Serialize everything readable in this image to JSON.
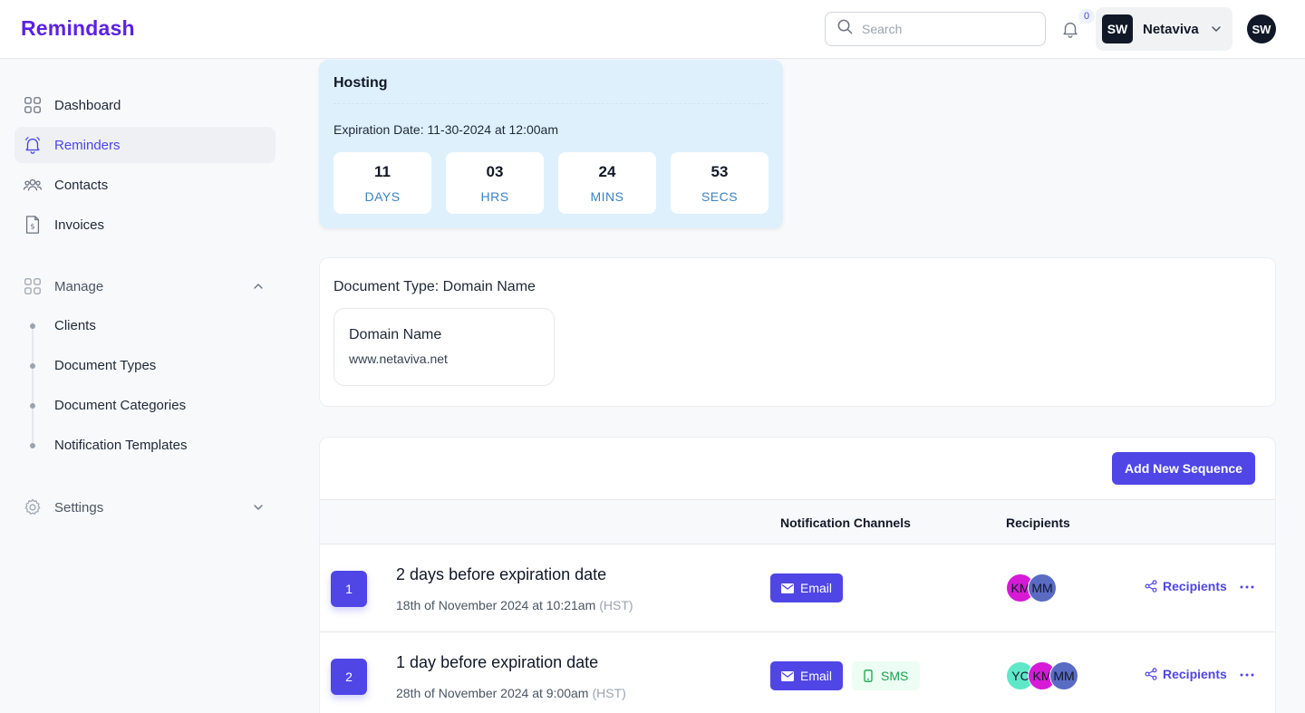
{
  "header": {
    "logo": "Remindash",
    "search_placeholder": "Search",
    "notification_count": "0",
    "account_initials": "SW",
    "account_name": "Netaviva",
    "user_initials": "SW"
  },
  "sidebar": {
    "items": [
      {
        "label": "Dashboard"
      },
      {
        "label": "Reminders"
      },
      {
        "label": "Contacts"
      },
      {
        "label": "Invoices"
      }
    ],
    "manage": {
      "label": "Manage",
      "children": [
        "Clients",
        "Document Types",
        "Document Categories",
        "Notification Templates"
      ]
    },
    "settings": {
      "label": "Settings"
    }
  },
  "hosting": {
    "title": "Hosting",
    "expiration": "Expiration Date: 11-30-2024 at 12:00am",
    "countdown": [
      {
        "value": "11",
        "unit": "DAYS"
      },
      {
        "value": "03",
        "unit": "HRS"
      },
      {
        "value": "24",
        "unit": "MINS"
      },
      {
        "value": "53",
        "unit": "SECS"
      }
    ]
  },
  "document": {
    "type_label": "Document Type: Domain Name",
    "field_title": "Domain Name",
    "field_value": "www.netaviva.net"
  },
  "sequences": {
    "add_button": "Add New Sequence",
    "columns": {
      "channels": "Notification Channels",
      "recipients": "Recipients"
    },
    "rows": [
      {
        "number": "1",
        "amount": "2 days",
        "suffix": "before expiration date",
        "date": "18th of November 2024 at 10:21am",
        "tz": "(HST)",
        "channels": {
          "email": "Email"
        },
        "avatars": [
          "KM",
          "MM"
        ],
        "recipients_link": "Recipients"
      },
      {
        "number": "2",
        "amount": "1 day",
        "suffix": "before expiration date",
        "date": "28th of November 2024 at 9:00am",
        "tz": "(HST)",
        "channels": {
          "email": "Email",
          "sms": "SMS"
        },
        "avatars": [
          "YC",
          "KM",
          "MM"
        ],
        "recipients_link": "Recipients"
      }
    ]
  },
  "colors": {
    "brand": "#5b21e6",
    "primary": "#4f46e5",
    "hosting_bg": "#dff0fd",
    "sms_green": "#16a34a",
    "avatar_km": "#d61ad6",
    "avatar_mm": "#5a6bc4",
    "avatar_yc": "#5ee8c8"
  }
}
